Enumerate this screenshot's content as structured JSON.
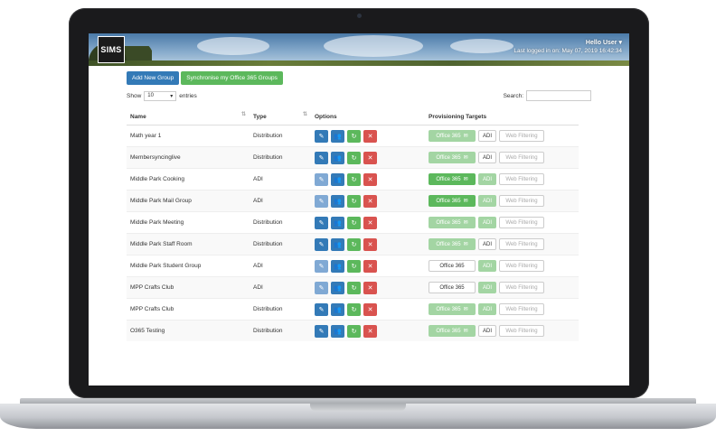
{
  "app": {
    "logo": "SIMS",
    "user_name": "Hello User ▾",
    "last_logged": "Last logged in on: May 07, 2019 16:42:34"
  },
  "toolbar": {
    "add_group_label": "Add New Group",
    "sync_label": "Synchronise my Office 365 Groups"
  },
  "controls": {
    "show_label": "Show",
    "entries_value": "10",
    "entries_label": "entries",
    "search_label": "Search:",
    "search_value": ""
  },
  "table": {
    "columns": [
      "Name",
      "Type",
      "Options",
      "Provisioning Targets"
    ],
    "target_labels": {
      "office": "Office 365",
      "adi": "ADI",
      "web": "Web Filtering"
    },
    "rows": [
      {
        "name": "Math year 1",
        "type": "Distribution"
      },
      {
        "name": "Membersyncinglive",
        "type": "Distribution"
      },
      {
        "name": "Middle Park Cooking",
        "type": "ADI"
      },
      {
        "name": "Middle Park Mail Group",
        "type": "ADI"
      },
      {
        "name": "Middle Park Meeting",
        "type": "Distribution"
      },
      {
        "name": "Middle Park Staff Room",
        "type": "Distribution"
      },
      {
        "name": "Middle Park Student Group",
        "type": "ADI"
      },
      {
        "name": "MPP Crafts Club",
        "type": "ADI"
      },
      {
        "name": "MPP Crafts Club",
        "type": "Distribution"
      },
      {
        "name": "O365 Testing",
        "type": "Distribution"
      }
    ]
  },
  "icons": {
    "edit": "pencil-icon",
    "users": "users-icon",
    "sync": "refresh-icon",
    "delete": "close-icon",
    "mail": "envelope-icon"
  },
  "colors": {
    "primary": "#337ab7",
    "success": "#5cb85c",
    "danger": "#d9534f"
  }
}
